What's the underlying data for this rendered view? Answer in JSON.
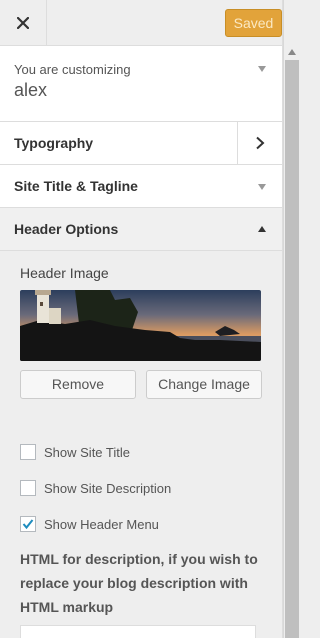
{
  "topbar": {
    "close_icon": "close-icon",
    "saved_label": "Saved",
    "accent_color": "#e2a33a"
  },
  "customizing": {
    "subtitle": "You are customizing",
    "theme_name": "alex"
  },
  "sections": {
    "typography": "Typography",
    "site_title": "Site Title & Tagline",
    "header_options": "Header Options"
  },
  "header_options": {
    "header_image_label": "Header Image",
    "remove_label": "Remove",
    "change_image_label": "Change Image",
    "checkboxes": [
      {
        "label": "Show Site Title",
        "checked": false
      },
      {
        "label": "Show Site Description",
        "checked": false
      },
      {
        "label": "Show Header Menu",
        "checked": true
      }
    ],
    "description_label": "HTML for description, if you wish to replace your blog description with HTML markup"
  }
}
